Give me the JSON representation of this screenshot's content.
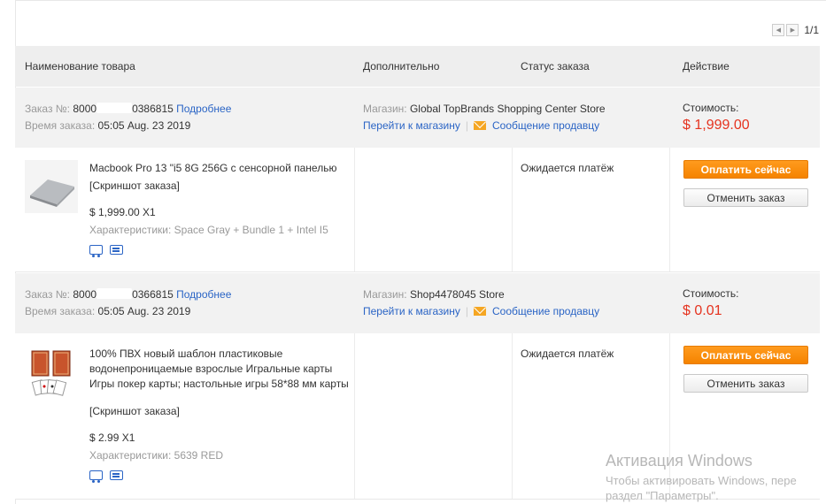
{
  "pagination": {
    "page": "1/1"
  },
  "table_header": {
    "product": "Наименование товара",
    "extra": "Дополнительно",
    "status": "Статус заказа",
    "action": "Действие"
  },
  "orders": [
    {
      "order_no_label": "Заказ №:",
      "order_no_prefix": "8000",
      "order_no_suffix": "0386815",
      "details_link": "Подробнее",
      "time_label": "Время заказа:",
      "time_value": "05:05 Aug. 23 2019",
      "store_label": "Магазин:",
      "store_name": "Global TopBrands Shopping Center Store",
      "go_store": "Перейти к магазину",
      "message_seller": "Сообщение продавцу",
      "cost_label": "Стоимость:",
      "cost_value": "$ 1,999.00",
      "product_title": "Macbook Pro 13 \"i5 8G 256G с сенсорной панелью",
      "screenshot": "[Скриншот заказа]",
      "price_qty": "$ 1,999.00 X1",
      "props": "Характеристики: Space Gray + Bundle 1 + Intel I5",
      "status": "Ожидается платёж",
      "pay_button": "Оплатить сейчас",
      "cancel_button": "Отменить заказ"
    },
    {
      "order_no_label": "Заказ №:",
      "order_no_prefix": "8000",
      "order_no_suffix": "0366815",
      "details_link": "Подробнее",
      "time_label": "Время заказа:",
      "time_value": "05:05 Aug. 23 2019",
      "store_label": "Магазин:",
      "store_name": "Shop4478045 Store",
      "go_store": "Перейти к магазину",
      "message_seller": "Сообщение продавцу",
      "cost_label": "Стоимость:",
      "cost_value": "$ 0.01",
      "product_title": "100% ПВХ новый шаблон пластиковые водонепроницаемые взрослые Игральные карты Игры покер карты; настольные игры 58*88 мм карты",
      "screenshot": "[Скриншот заказа]",
      "price_qty": "$ 2.99 X1",
      "props": "Характеристики: 5639 RED",
      "status": "Ожидается платёж",
      "pay_button": "Оплатить сейчас",
      "cancel_button": "Отменить заказ"
    }
  ],
  "watermark": {
    "line1": "Активация Windows",
    "line2": "Чтобы активировать Windows, пере",
    "line3": "раздел \"Параметры\"."
  },
  "colors": {
    "accent_link": "#2a64c5",
    "price_red": "#e5331f",
    "pay_orange": "#f58300"
  }
}
